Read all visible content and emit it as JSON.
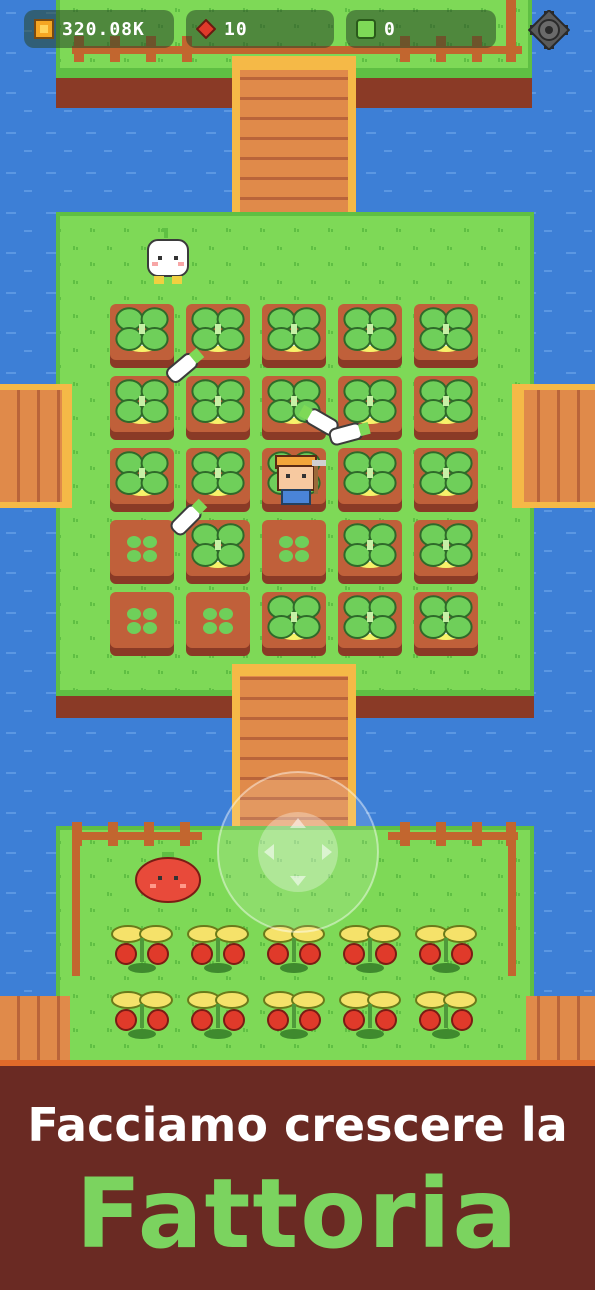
{
  "hud": {
    "coins": {
      "icon": "coin-icon",
      "value": "320.08K"
    },
    "gems": {
      "icon": "red-gem-icon",
      "value": "10"
    },
    "tickets": {
      "icon": "green-ticket-icon",
      "value": "0"
    },
    "settings": {
      "icon": "gear-icon"
    }
  },
  "banner": {
    "line1": "Facciamo crescere la",
    "line2": "Fattoria"
  },
  "colors": {
    "water": "#3d7fd6",
    "grass": "#7ed957",
    "soil": "#b8542e",
    "wood": "#e08a4a",
    "banner_bg": "#6a2a23",
    "banner_accent": "#7bd35f"
  },
  "game": {
    "turnip_field": {
      "rows": [
        [
          "grown",
          "grown",
          "grown",
          "grown",
          "grown"
        ],
        [
          "grown",
          "grown",
          "grown",
          "grown",
          "grown"
        ],
        [
          "grown",
          "grown",
          "grown",
          "grown",
          "grown"
        ],
        [
          "sprout",
          "grown",
          "sprout",
          "grown",
          "grown"
        ],
        [
          "sprout",
          "sprout",
          "grown",
          "grown",
          "grown"
        ]
      ]
    },
    "tomato_field": {
      "rows": 2,
      "cols": 5
    }
  }
}
